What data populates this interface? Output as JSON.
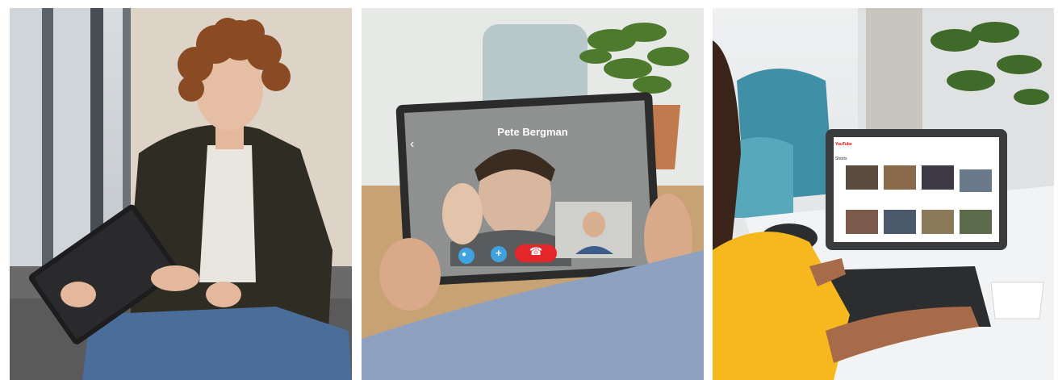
{
  "panels": [
    {
      "id": "tablet-user-boy",
      "scene": "teen with curly hair using a black tablet on a sofa"
    },
    {
      "id": "video-call",
      "scene": "hands holding a tablet showing a video call"
    },
    {
      "id": "tablet-with-keyboard",
      "scene": "woman typing on a tablet with keyboard case"
    }
  ],
  "video_call": {
    "caller_name": "Pete Bergman"
  },
  "youtube_screen": {
    "logo": "YouTube",
    "section": "Shorts"
  },
  "colors": {
    "end_call_red": "#e5262b",
    "call_button_blue": "#3fa3e0",
    "youtube_red": "#ff0000",
    "hoodie_yellow": "#f6b81c"
  }
}
